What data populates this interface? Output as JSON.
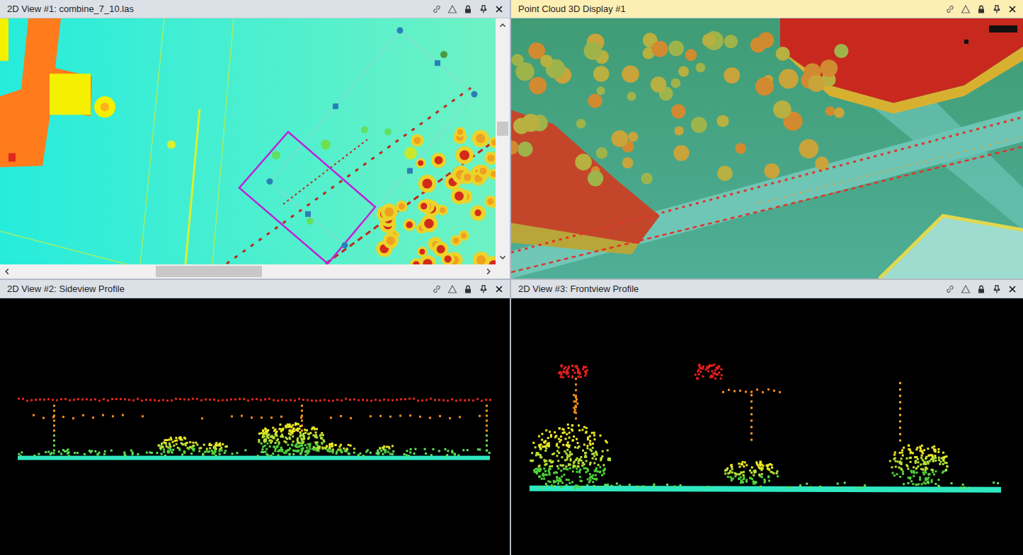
{
  "panels": [
    {
      "title": "2D View #1: combine_7_10.las",
      "active": false,
      "kind": "map"
    },
    {
      "title": "Point Cloud 3D Display #1",
      "active": true,
      "kind": "scene"
    },
    {
      "title": "2D View #2: Sideview Profile",
      "active": false,
      "kind": "side"
    },
    {
      "title": "2D View #3: Frontview Profile",
      "active": false,
      "kind": "front"
    }
  ]
}
